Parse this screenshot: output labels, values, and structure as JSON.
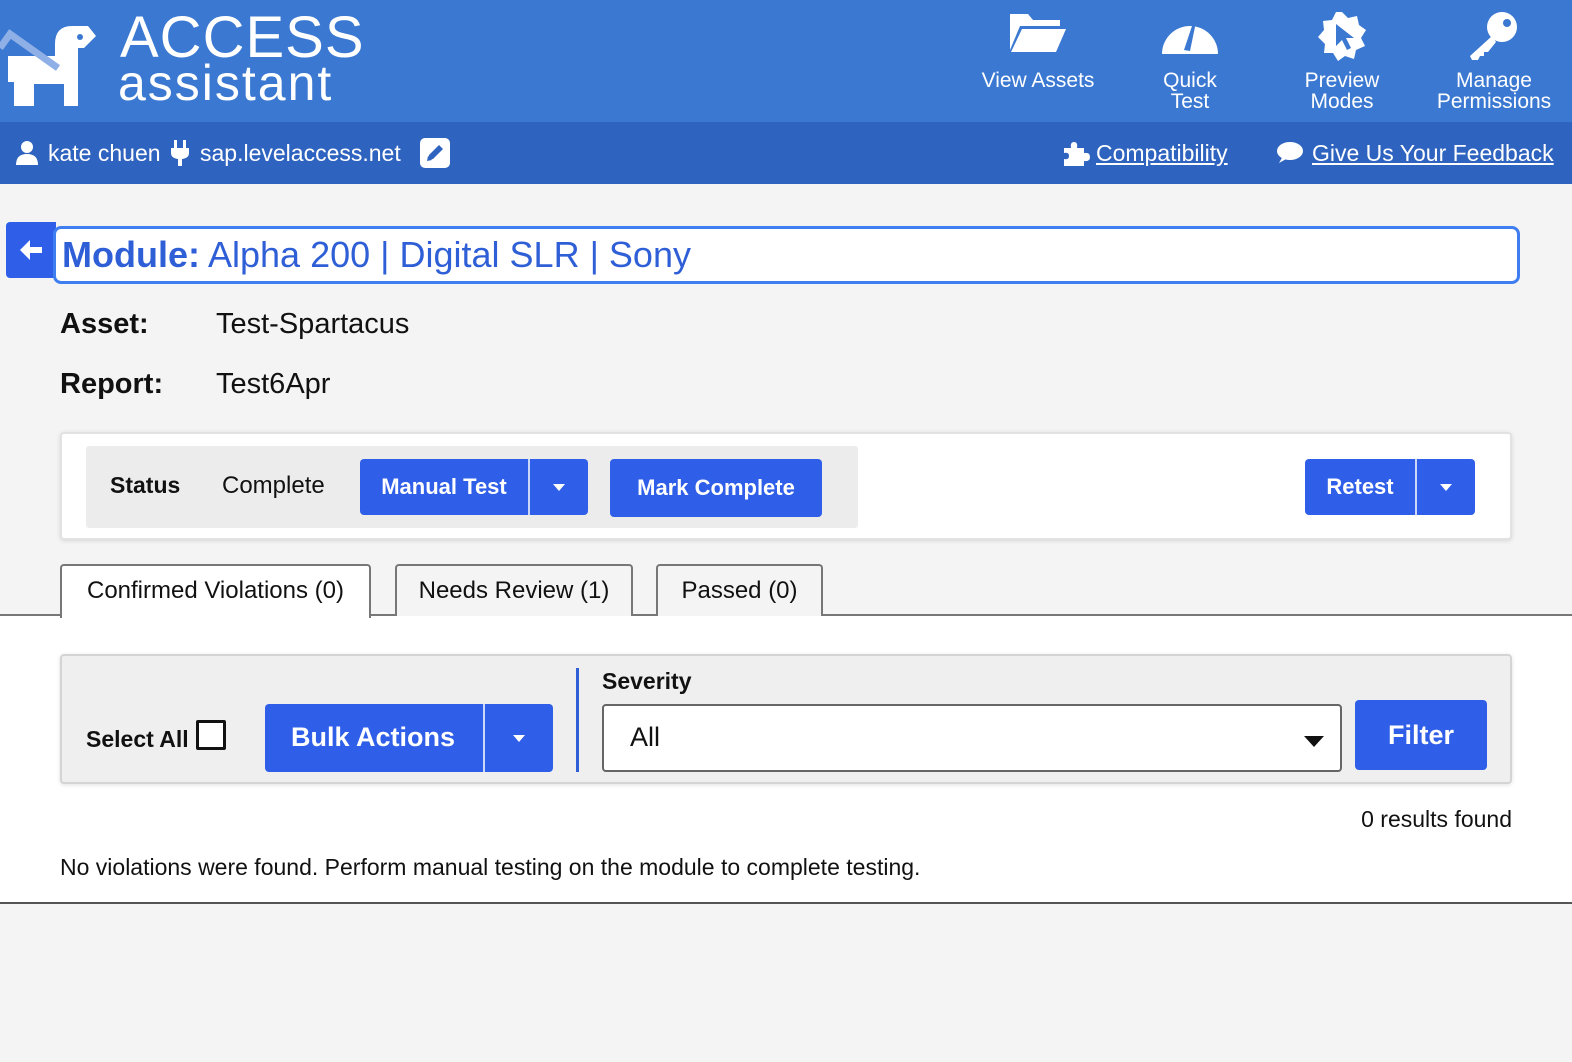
{
  "header": {
    "logo": {
      "line1": "ACCESS",
      "line2": "assistant"
    },
    "nav": [
      {
        "label": "View Assets",
        "icon": "folder-open-icon"
      },
      {
        "label": "Quick\nTest",
        "icon": "speedometer-icon"
      },
      {
        "label": "Preview\nModes",
        "icon": "cursor-badge-icon"
      },
      {
        "label": "Manage\nPermissions",
        "icon": "key-icon"
      }
    ]
  },
  "subheader": {
    "user": "kate chuen",
    "server": "sap.levelaccess.net",
    "compatibility": "Compatibility",
    "feedback": "Give Us Your Feedback"
  },
  "module": {
    "label": "Module:",
    "name": "Alpha 200 | Digital SLR | Sony"
  },
  "asset": {
    "label": "Asset:",
    "value": "Test-Spartacus"
  },
  "report": {
    "label": "Report:",
    "value": "Test6Apr"
  },
  "status": {
    "label": "Status",
    "value": "Complete",
    "manual_test": "Manual Test",
    "mark_complete": "Mark Complete",
    "retest": "Retest"
  },
  "tabs": [
    {
      "label": "Confirmed Violations (0)",
      "active": true
    },
    {
      "label": "Needs Review (1)",
      "active": false
    },
    {
      "label": "Passed (0)",
      "active": false
    }
  ],
  "filters": {
    "select_all": "Select All",
    "bulk_actions": "Bulk Actions",
    "severity_label": "Severity",
    "severity_value": "All",
    "filter_button": "Filter"
  },
  "results": {
    "count_text": "0 results found",
    "message": "No violations were found. Perform manual testing on the module to complete testing."
  },
  "colors": {
    "header_bg": "#3a78d1",
    "subheader_bg": "#2e63bf",
    "primary_button": "#2f5fe8",
    "link_blue": "#2f5fd6"
  }
}
